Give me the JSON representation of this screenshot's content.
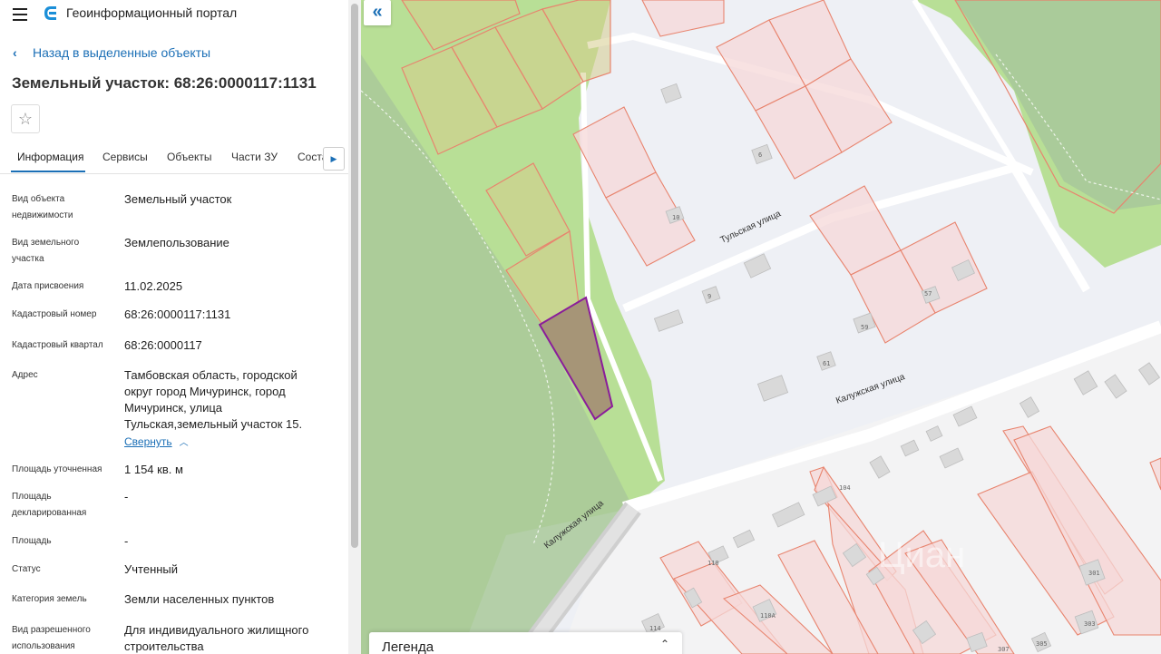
{
  "header": {
    "menu_icon": "menu-icon",
    "logo_icon": "geoportal-logo",
    "title": "Геоинформационный портал"
  },
  "back_link": "Назад в выделенные объекты",
  "page_title": "Земельный участок: 68:26:0000117:1131",
  "favorite_icon": "star-icon",
  "tabs": [
    "Информация",
    "Сервисы",
    "Объекты",
    "Части ЗУ",
    "Соста"
  ],
  "active_tab": "Информация",
  "fields": [
    {
      "label": "Вид объекта недвижимости",
      "value": "Земельный участок"
    },
    {
      "label": "Вид земельного участка",
      "value": "Землепользование"
    },
    {
      "label": "Дата присвоения",
      "value": "11.02.2025"
    },
    {
      "label": "Кадастровый номер",
      "value": "68:26:0000117:1131"
    },
    {
      "label": "Кадастровый квартал",
      "value": "68:26:0000117"
    },
    {
      "label": "Адрес",
      "value": "Тамбовская область, городской округ город Мичуринск, город Мичуринск, улица Тульская,земельный участок 15."
    },
    {
      "label": "Площадь уточненная",
      "value": "1 154 кв. м"
    },
    {
      "label": "Площадь декларированная",
      "value": "-"
    },
    {
      "label": "Площадь",
      "value": "-"
    },
    {
      "label": "Статус",
      "value": "Учтенный"
    },
    {
      "label": "Категория земель",
      "value": "Земли населенных пунктов"
    },
    {
      "label": "Вид разрешенного использования",
      "value": "Для индивидуального жилищного строительства"
    }
  ],
  "collapse_link": "Свернуть",
  "map": {
    "collapse_icon": "double-chevron-left-icon",
    "streets": [
      "Тульская улица",
      "Калужская улица",
      "Калужская улица"
    ],
    "house_numbers": [
      "6",
      "10",
      "9",
      "57",
      "59",
      "61",
      "104",
      "110",
      "110А",
      "114",
      "301",
      "303",
      "305",
      "307"
    ],
    "watermark": "Циан",
    "colors": {
      "park": "#b8df96",
      "forest": "#a9c99a",
      "parcel_stroke": "#e8846e",
      "parcel_fill": "#f5d8d8",
      "selected_stroke": "#8a1d9a",
      "selected_fill": "#a69577"
    }
  },
  "legend": {
    "title": "Легенда",
    "toggle_icon": "expand-toggle-icon"
  }
}
